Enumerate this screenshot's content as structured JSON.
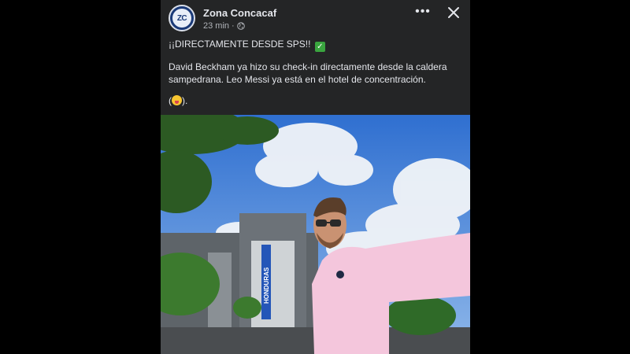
{
  "post": {
    "page_name": "Zona Concacaf",
    "avatar_text": "ZC",
    "timestamp": "23 min",
    "separator": "·",
    "privacy_icon": "globe-icon",
    "more_label": "•••",
    "close_icon": "close-icon",
    "headline": "¡¡DIRECTAMENTE DESDE SPS!!",
    "headline_emoji": "check-mark-emoji",
    "body": "David Beckham ya hizo su check-in directamente desde la caldera sampedrana. Leo Messi ya está en el hotel de concentración.",
    "emoji_line_open": "(",
    "emoji_line_close": ").",
    "emoji": "tongue-out-face-emoji"
  },
  "photo": {
    "stadium_banner": "HONDURAS"
  },
  "colors": {
    "post_background": "#242526",
    "text": "#e4e6eb",
    "secondary_text": "#b0b3b8",
    "brand_blue": "#1a3a78"
  }
}
